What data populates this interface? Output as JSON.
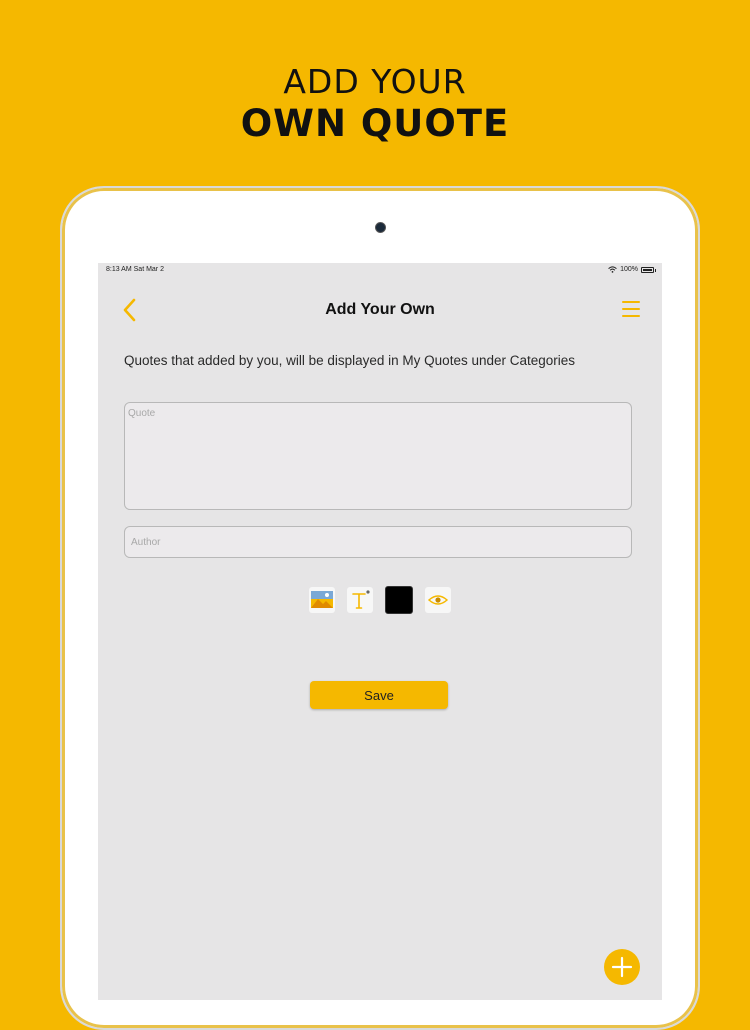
{
  "promo": {
    "line1": "ADD YOUR",
    "line2": "OWN QUOTE"
  },
  "status_bar": {
    "time_date": "8:13 AM  Sat Mar 2",
    "battery": "100%"
  },
  "header": {
    "title": "Add Your Own",
    "back_icon": "chevron-left-icon",
    "menu_icon": "hamburger-menu-icon"
  },
  "info_text": "Quotes that added by you, will be displayed in My Quotes under Categories",
  "form": {
    "quote_placeholder": "Quote",
    "quote_value": "",
    "author_placeholder": "Author",
    "author_value": ""
  },
  "tools": {
    "image_icon": "image-icon",
    "text_icon": "text-style-icon",
    "color_icon": "color-swatch-icon",
    "preview_icon": "eye-icon",
    "selected_color": "#000000"
  },
  "save_label": "Save",
  "fab_icon": "plus-icon",
  "colors": {
    "brand": "#F5B800",
    "screen_bg": "#E6E5E6",
    "text_dark": "#111111"
  }
}
